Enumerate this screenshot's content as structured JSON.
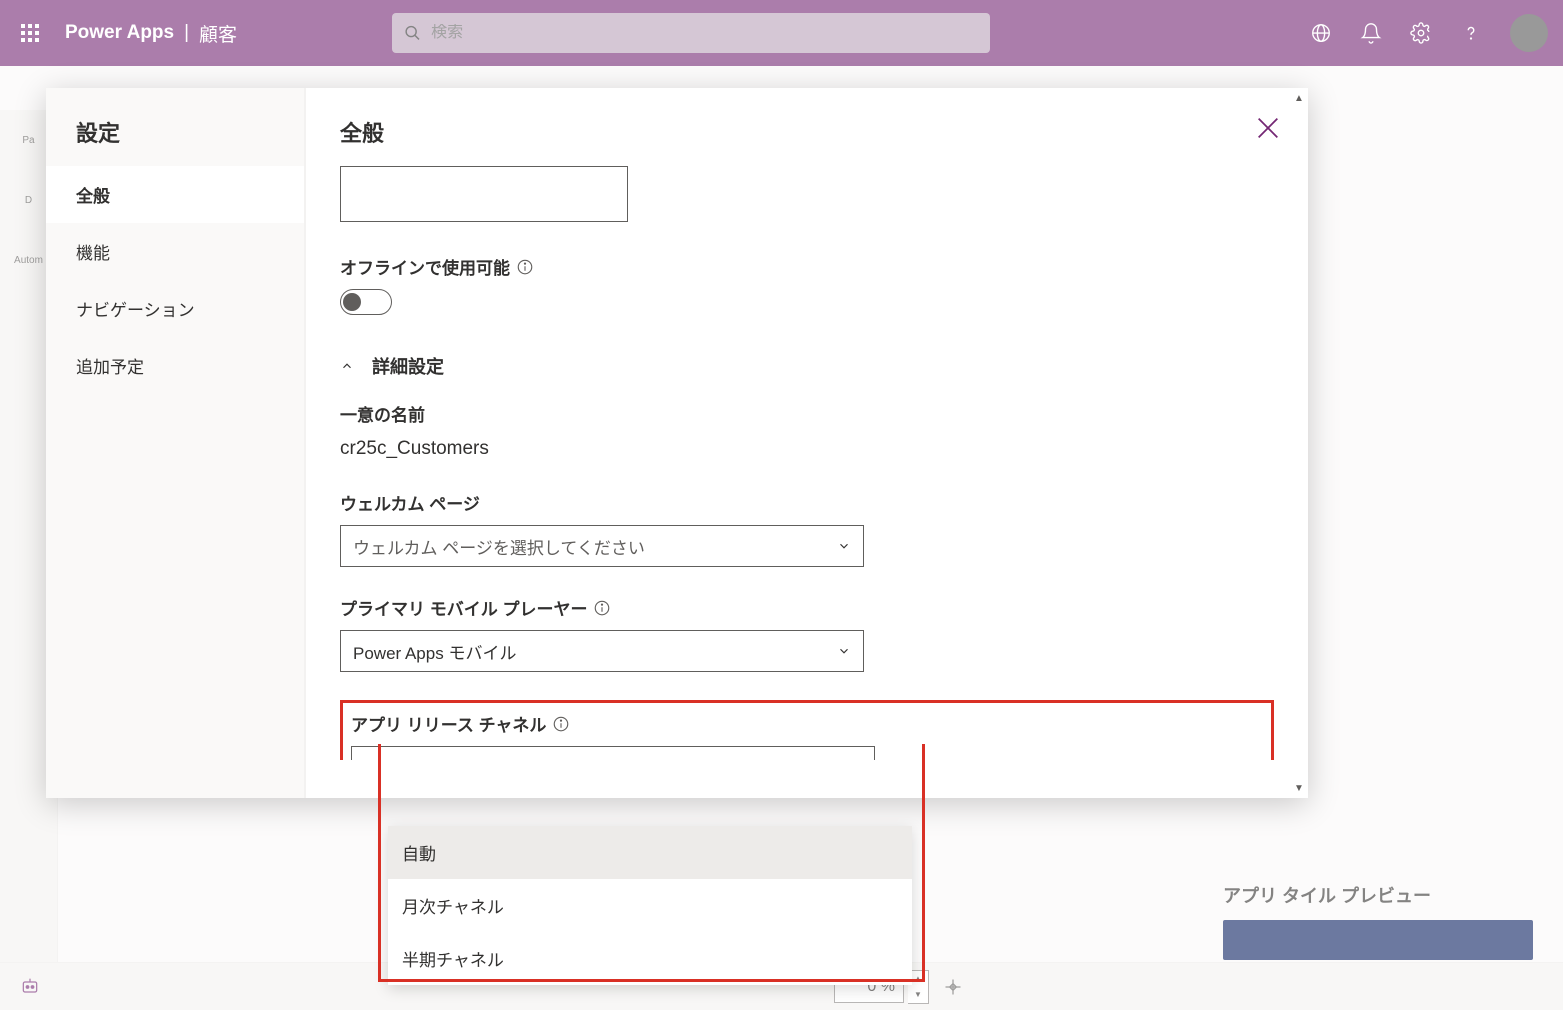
{
  "header": {
    "app_name": "Power Apps",
    "divider": "|",
    "page_title": "顧客",
    "search_placeholder": "検索"
  },
  "bg": {
    "rail": {
      "d": "D",
      "p": "Pa",
      "autom": "Autom"
    }
  },
  "bottom": {
    "zoom_percent": "0 %",
    "preview_title": "アプリ タイル プレビュー"
  },
  "settings": {
    "title": "設定",
    "nav": {
      "general": "全般",
      "features": "機能",
      "navigation": "ナビゲーション",
      "upcoming": "追加予定"
    },
    "general": {
      "title": "全般",
      "offline_label": "オフラインで使用可能",
      "advanced_section": "詳細設定",
      "unique_name_label": "一意の名前",
      "unique_name_value": "cr25c_Customers",
      "welcome_page_label": "ウェルカム ページ",
      "welcome_page_placeholder": "ウェルカム ページを選択してください",
      "mobile_player_label": "プライマリ モバイル プレーヤー",
      "mobile_player_value": "Power Apps モバイル",
      "release_channel_label": "アプリ リリース チャネル",
      "release_channel_value": "自動",
      "release_options": {
        "auto": "自動",
        "monthly": "月次チャネル",
        "semi": "半期チャネル"
      }
    }
  }
}
